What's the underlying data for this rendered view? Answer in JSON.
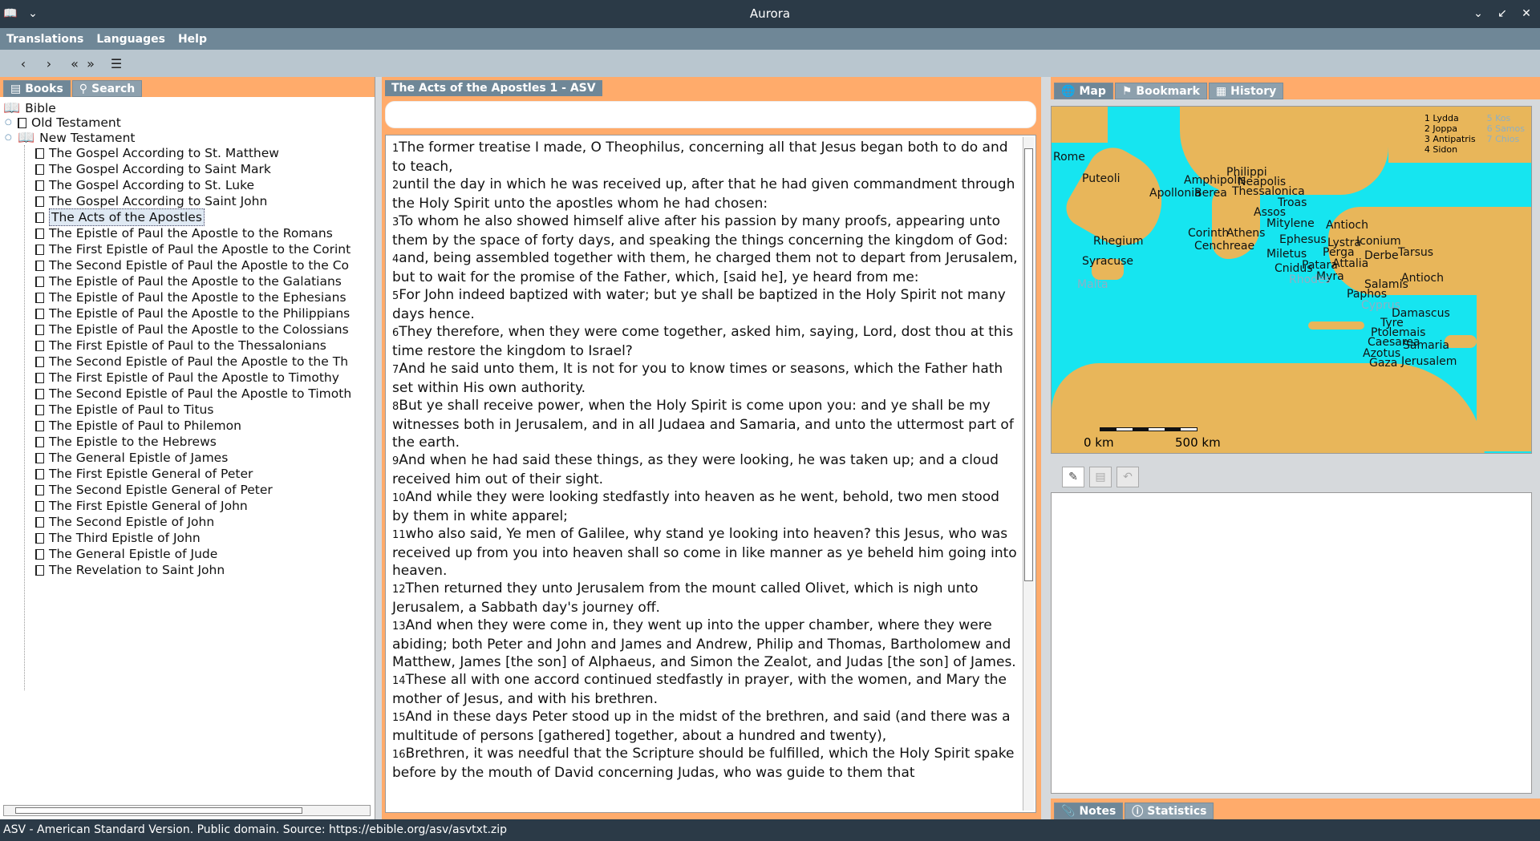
{
  "window": {
    "title": "Aurora"
  },
  "menu": [
    "Translations",
    "Languages",
    "Help"
  ],
  "left_tabs": [
    {
      "label": "Books",
      "icon": "book-icon"
    },
    {
      "label": "Search",
      "icon": "search-icon"
    }
  ],
  "tree": {
    "root": "Bible",
    "old_testament": "Old Testament",
    "new_testament": "New Testament",
    "books": [
      "The Gospel According to St. Matthew",
      "The Gospel According to Saint Mark",
      "The Gospel According to St. Luke",
      "The Gospel According to Saint John",
      "The Acts of the Apostles",
      "The Epistle of Paul the Apostle to the Romans",
      "The First Epistle of Paul the Apostle to the Corint",
      "The Second Epistle of Paul the Apostle to the Co",
      "The Epistle of Paul the Apostle to the Galatians",
      "The Epistle of Paul the Apostle to the Ephesians",
      "The Epistle of Paul the Apostle to the Philippians",
      "The Epistle of Paul the Apostle to the Colossians",
      "The First Epistle of Paul to the Thessalonians",
      "The Second Epistle of Paul the Apostle to the Th",
      "The First Epistle of Paul the Apostle to Timothy",
      "The Second Epistle of Paul the Apostle to Timoth",
      "The Epistle of Paul to Titus",
      "The Epistle of Paul to Philemon",
      "The Epistle to the Hebrews",
      "The General Epistle of James",
      "The First Epistle General of Peter",
      "The Second Epistle General of Peter",
      "The First Epistle General of John",
      "The Second Epistle of John",
      "The Third Epistle of John",
      "The General Epistle of Jude",
      "The Revelation to Saint John"
    ],
    "selected_index": 4
  },
  "reader": {
    "tab_title": "The Acts of the Apostles 1 - ASV",
    "verses": [
      {
        "n": "1",
        "text": "The former treatise I made, O Theophilus, concerning all that Jesus began both to do and to teach,"
      },
      {
        "n": "2",
        "text": "until the day in which he was received up, after that he had given commandment through the Holy Spirit unto the apostles whom he had chosen:"
      },
      {
        "n": "3",
        "text": "To whom he also showed himself alive after his passion by many proofs, appearing unto them by the space of forty days, and speaking the things concerning the kingdom of God:"
      },
      {
        "n": "4",
        "text": "and, being assembled together with them, he charged them not to depart from Jerusalem, but to wait for the promise of the Father, which, [said he], ye heard from me:"
      },
      {
        "n": "5",
        "text": "For John indeed baptized with water; but ye shall be baptized in the Holy Spirit not many days hence."
      },
      {
        "n": "6",
        "text": "They therefore, when they were come together, asked him, saying, Lord, dost thou at this time restore the kingdom to Israel?"
      },
      {
        "n": "7",
        "text": "And he said unto them, It is not for you to know times or seasons, which the Father hath set within His own authority."
      },
      {
        "n": "8",
        "text": "But ye shall receive power, when the Holy Spirit is come upon you: and ye shall be my witnesses both in Jerusalem, and in all Judaea and Samaria, and unto the uttermost part of the earth."
      },
      {
        "n": "9",
        "text": "And when he had said these things, as they were looking, he was taken up; and a cloud received him out of their sight."
      },
      {
        "n": "10",
        "text": "And while they were looking stedfastly into heaven as he went, behold, two men stood by them in white apparel;"
      },
      {
        "n": "11",
        "text": "who also said, Ye men of Galilee, why stand ye looking into heaven? this Jesus, who was received up from you into heaven shall so come in like manner as ye beheld him going into heaven."
      },
      {
        "n": "12",
        "text": "Then returned they unto Jerusalem from the mount called Olivet, which is nigh unto Jerusalem, a Sabbath day's journey off."
      },
      {
        "n": "13",
        "text": "And when they were come in, they went up into the upper chamber, where they were abiding; both Peter and John and James and Andrew, Philip and Thomas, Bartholomew and Matthew, James [the son] of Alphaeus, and Simon the Zealot, and Judas [the son] of James."
      },
      {
        "n": "14",
        "text": "These all with one accord continued stedfastly in prayer, with the women, and Mary the mother of Jesus, and with his brethren."
      },
      {
        "n": "15",
        "text": "And in these days Peter stood up in the midst of the brethren, and said (and there was a multitude of persons [gathered] together, about a hundred and twenty),"
      },
      {
        "n": "16",
        "text": "Brethren, it was needful that the Scripture should be fulfilled, which the Holy Spirit spake before by the mouth of David concerning Judas, who was guide to them that"
      }
    ]
  },
  "right_tabs": [
    {
      "label": "Map",
      "icon": "globe-icon"
    },
    {
      "label": "Bookmark",
      "icon": "bookmark-icon"
    },
    {
      "label": "History",
      "icon": "calendar-icon"
    }
  ],
  "map": {
    "legend_left": [
      "1 Lydda",
      "2 Joppa",
      "3 Antipatris",
      "4 Sidon"
    ],
    "legend_right": [
      "5 Kos",
      "6 Samos",
      "7 Chios"
    ],
    "scale_start": "0 km",
    "scale_end": "500 km",
    "cities": [
      {
        "name": "Rome",
        "dim": false
      },
      {
        "name": "Puteoli",
        "dim": false
      },
      {
        "name": "Apollonia",
        "dim": false
      },
      {
        "name": "Amphipolis",
        "dim": false
      },
      {
        "name": "Philippi",
        "dim": false
      },
      {
        "name": "Neapolis",
        "dim": false
      },
      {
        "name": "Berea",
        "dim": false
      },
      {
        "name": "Thessalonica",
        "dim": false
      },
      {
        "name": "Troas",
        "dim": false
      },
      {
        "name": "Assos",
        "dim": false
      },
      {
        "name": "Mitylene",
        "dim": false
      },
      {
        "name": "Antioch",
        "dim": false
      },
      {
        "name": "Rhegium",
        "dim": false
      },
      {
        "name": "Corinth",
        "dim": false
      },
      {
        "name": "Athens",
        "dim": false
      },
      {
        "name": "Ephesus",
        "dim": false
      },
      {
        "name": "Lystra",
        "dim": false
      },
      {
        "name": "Iconium",
        "dim": false
      },
      {
        "name": "Cenchreae",
        "dim": false
      },
      {
        "name": "Perga",
        "dim": false
      },
      {
        "name": "Derbe",
        "dim": false
      },
      {
        "name": "Tarsus",
        "dim": false
      },
      {
        "name": "Miletus",
        "dim": false
      },
      {
        "name": "Syracuse",
        "dim": false
      },
      {
        "name": "Attalia",
        "dim": false
      },
      {
        "name": "Cnidus",
        "dim": false
      },
      {
        "name": "Patara",
        "dim": false
      },
      {
        "name": "Myra",
        "dim": false
      },
      {
        "name": "Antioch",
        "dim": false
      },
      {
        "name": "Malta",
        "dim": true
      },
      {
        "name": "Rhodes",
        "dim": true
      },
      {
        "name": "Salamis",
        "dim": false
      },
      {
        "name": "Paphos",
        "dim": false
      },
      {
        "name": "Cyprus",
        "dim": true
      },
      {
        "name": "Damascus",
        "dim": false
      },
      {
        "name": "Tyre",
        "dim": false
      },
      {
        "name": "Ptolemais",
        "dim": false
      },
      {
        "name": "Caesarea",
        "dim": false
      },
      {
        "name": "Samaria",
        "dim": false
      },
      {
        "name": "Azotus",
        "dim": false
      },
      {
        "name": "Jerusalem",
        "dim": false
      },
      {
        "name": "Gaza",
        "dim": false
      }
    ]
  },
  "bottom_tabs": [
    {
      "label": "Notes",
      "icon": "paperclip-icon"
    },
    {
      "label": "Statistics",
      "icon": "info-icon"
    }
  ],
  "status": "ASV - American Standard Version. Public domain. Source: https://ebible.org/asv/asvtxt.zip"
}
